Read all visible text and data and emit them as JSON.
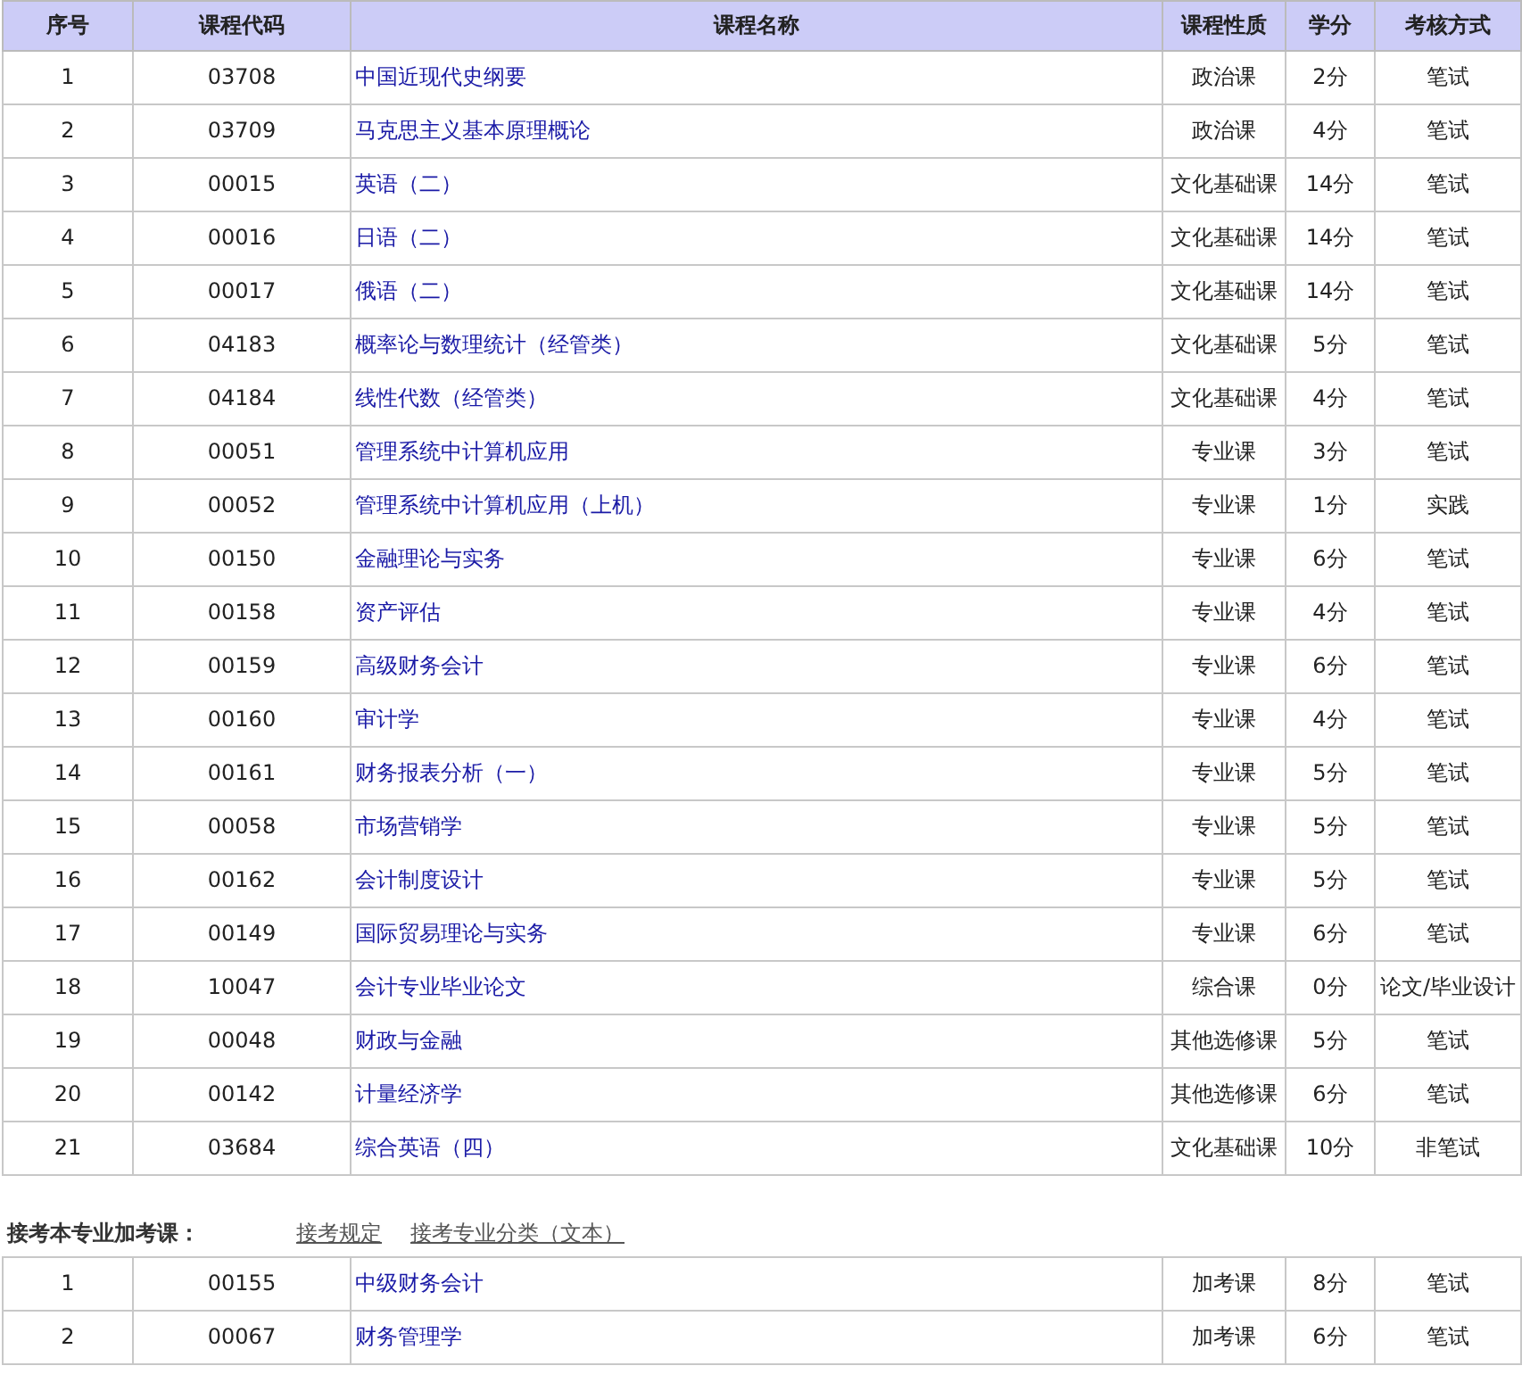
{
  "table": {
    "columns": [
      "序号",
      "课程代码",
      "课程名称",
      "课程性质",
      "学分",
      "考核方式"
    ],
    "rows": [
      [
        "1",
        "03708",
        "中国近现代史纲要",
        "政治课",
        "2分",
        "笔试"
      ],
      [
        "2",
        "03709",
        "马克思主义基本原理概论",
        "政治课",
        "4分",
        "笔试"
      ],
      [
        "3",
        "00015",
        "英语（二）",
        "文化基础课",
        "14分",
        "笔试"
      ],
      [
        "4",
        "00016",
        "日语（二）",
        "文化基础课",
        "14分",
        "笔试"
      ],
      [
        "5",
        "00017",
        "俄语（二）",
        "文化基础课",
        "14分",
        "笔试"
      ],
      [
        "6",
        "04183",
        "概率论与数理统计（经管类）",
        "文化基础课",
        "5分",
        "笔试"
      ],
      [
        "7",
        "04184",
        "线性代数（经管类）",
        "文化基础课",
        "4分",
        "笔试"
      ],
      [
        "8",
        "00051",
        "管理系统中计算机应用",
        "专业课",
        "3分",
        "笔试"
      ],
      [
        "9",
        "00052",
        "管理系统中计算机应用（上机）",
        "专业课",
        "1分",
        "实践"
      ],
      [
        "10",
        "00150",
        "金融理论与实务",
        "专业课",
        "6分",
        "笔试"
      ],
      [
        "11",
        "00158",
        "资产评估",
        "专业课",
        "4分",
        "笔试"
      ],
      [
        "12",
        "00159",
        "高级财务会计",
        "专业课",
        "6分",
        "笔试"
      ],
      [
        "13",
        "00160",
        "审计学",
        "专业课",
        "4分",
        "笔试"
      ],
      [
        "14",
        "00161",
        "财务报表分析（一）",
        "专业课",
        "5分",
        "笔试"
      ],
      [
        "15",
        "00058",
        "市场营销学",
        "专业课",
        "5分",
        "笔试"
      ],
      [
        "16",
        "00162",
        "会计制度设计",
        "专业课",
        "5分",
        "笔试"
      ],
      [
        "17",
        "00149",
        "国际贸易理论与实务",
        "专业课",
        "6分",
        "笔试"
      ],
      [
        "18",
        "10047",
        "会计专业毕业论文",
        "综合课",
        "0分",
        "论文/毕业设计"
      ],
      [
        "19",
        "00048",
        "财政与金融",
        "其他选修课",
        "5分",
        "笔试"
      ],
      [
        "20",
        "00142",
        "计量经济学",
        "其他选修课",
        "6分",
        "笔试"
      ],
      [
        "21",
        "03684",
        "综合英语（四）",
        "文化基础课",
        "10分",
        "非笔试"
      ]
    ]
  },
  "extra_section": {
    "title": "接考本专业加考课：",
    "links": [
      "接考规定",
      "接考专业分类（文本）"
    ],
    "rows": [
      [
        "1",
        "00155",
        "中级财务会计",
        "加考课",
        "8分",
        "笔试"
      ],
      [
        "2",
        "00067",
        "财务管理学",
        "加考课",
        "6分",
        "笔试"
      ]
    ]
  }
}
